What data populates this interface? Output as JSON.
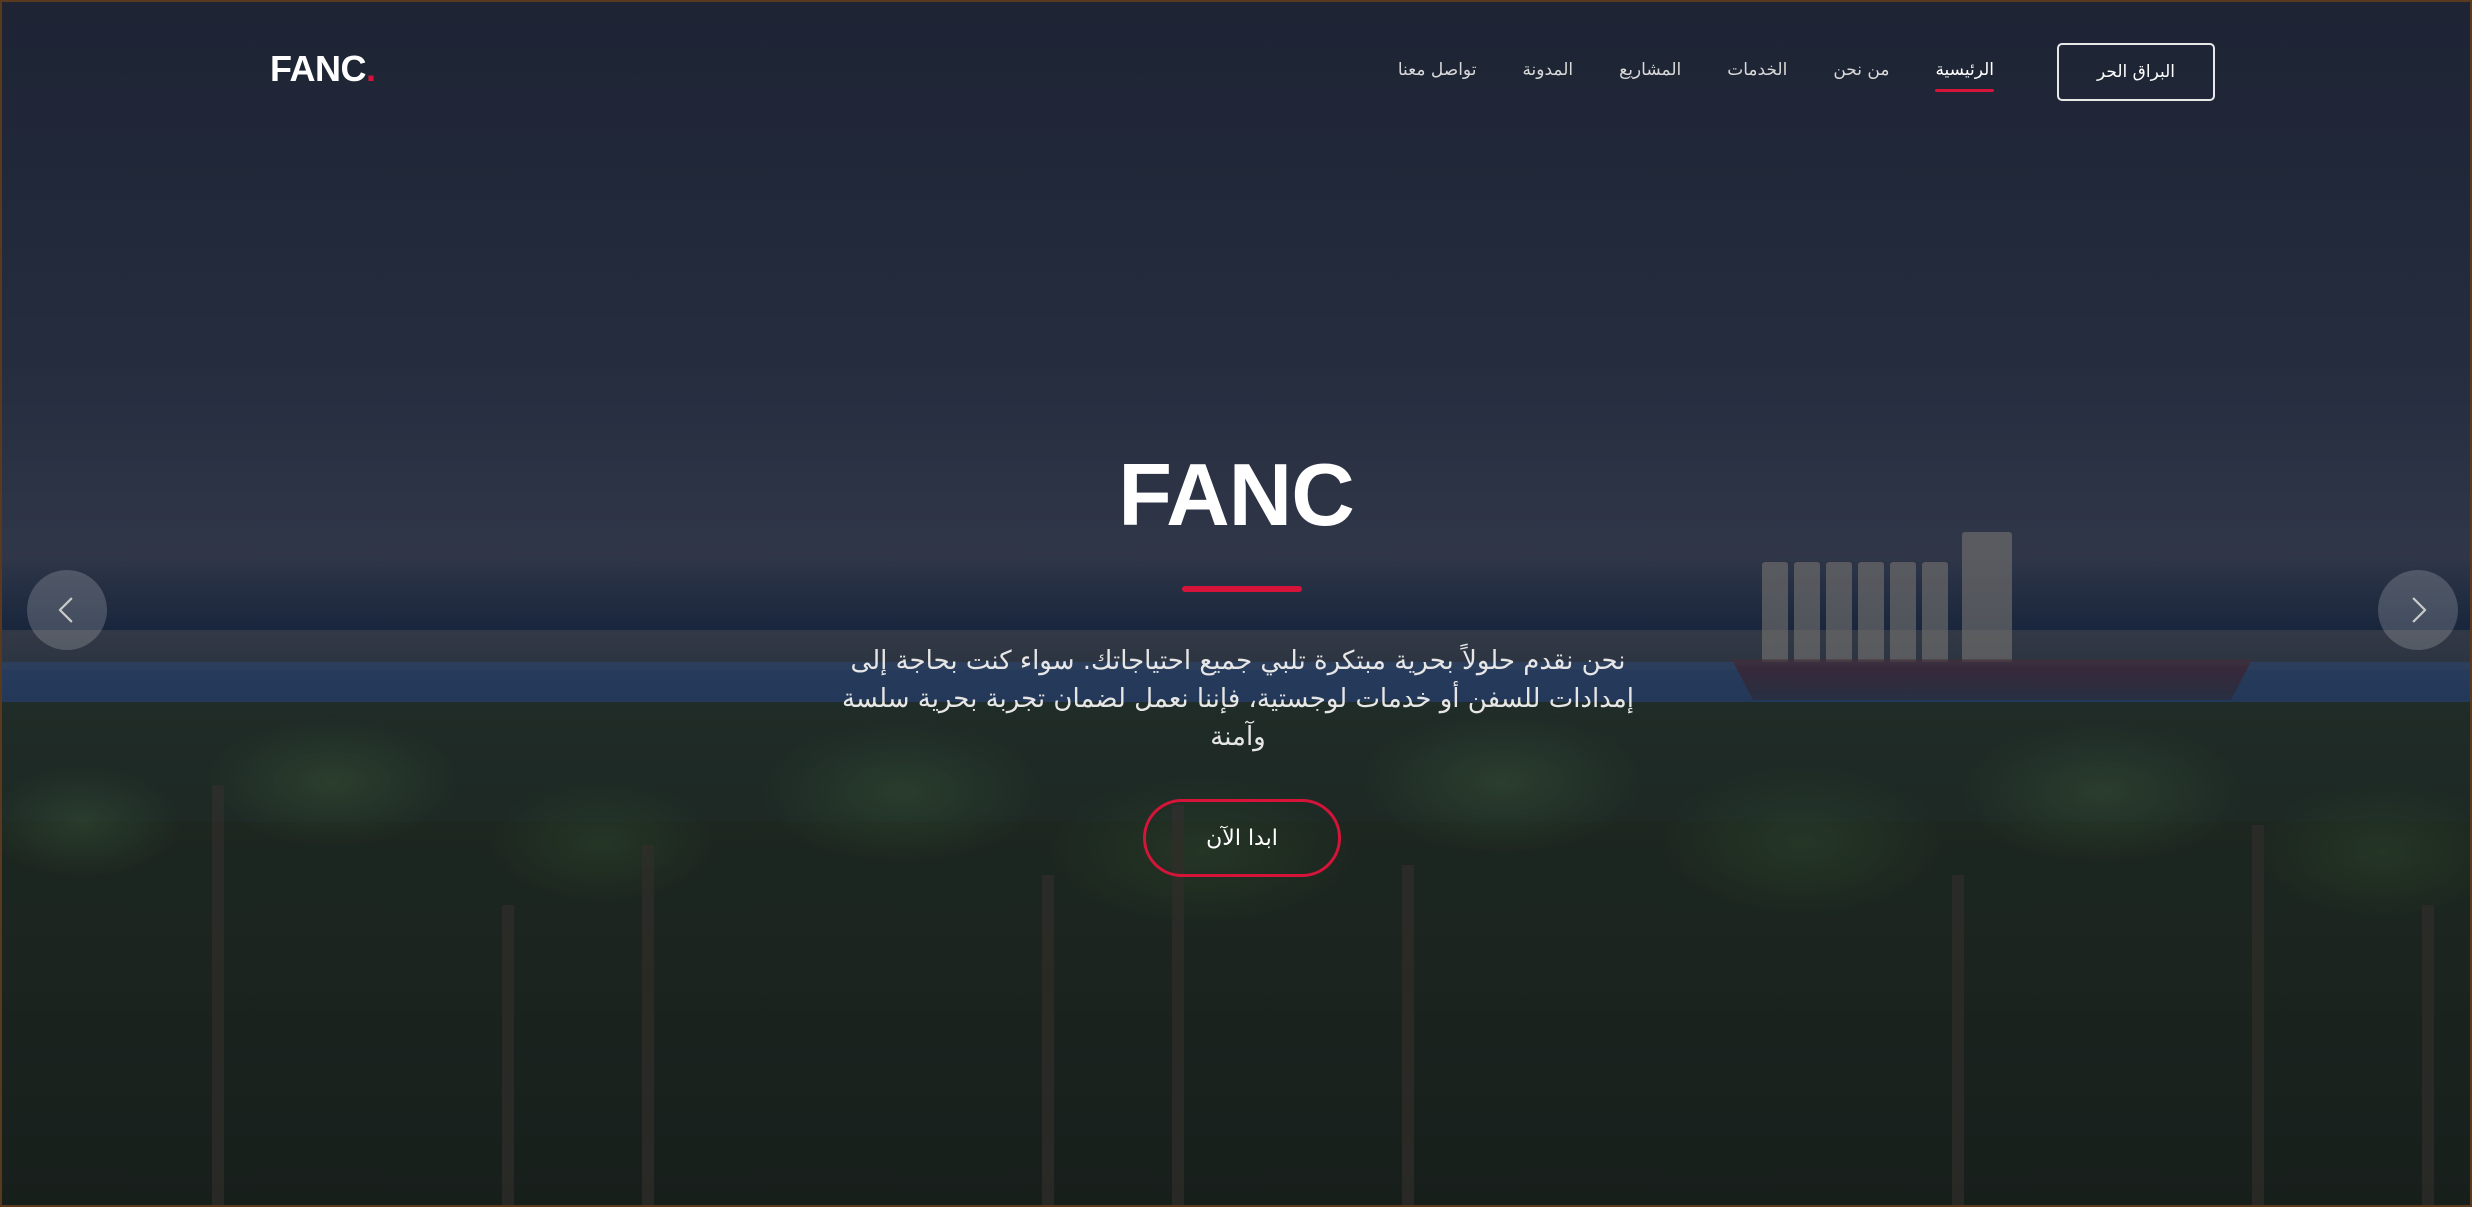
{
  "header": {
    "logo_text": "FANC",
    "logo_dot": ".",
    "nav_items": [
      {
        "label": "الرئيسية",
        "active": true
      },
      {
        "label": "من نحن",
        "active": false
      },
      {
        "label": "الخدمات",
        "active": false
      },
      {
        "label": "المشاريع",
        "active": false
      },
      {
        "label": "المدونة",
        "active": false
      },
      {
        "label": "تواصل معنا",
        "active": false
      }
    ],
    "cta_label": "البراق الحر"
  },
  "hero": {
    "title": "FANC",
    "description": "نحن نقدم حلولاً بحرية مبتكرة تلبي جميع احتياجاتك. سواء كنت بحاجة إلى إمدادات للسفن أو خدمات لوجستية، فإننا نعمل لضمان تجربة بحرية سلسة وآمنة",
    "cta_label": "ابدا الآن"
  },
  "carousel": {
    "prev_icon": "chevron-left-icon",
    "next_icon": "chevron-right-icon"
  },
  "colors": {
    "accent": "#d6143a",
    "text": "#ffffff"
  }
}
